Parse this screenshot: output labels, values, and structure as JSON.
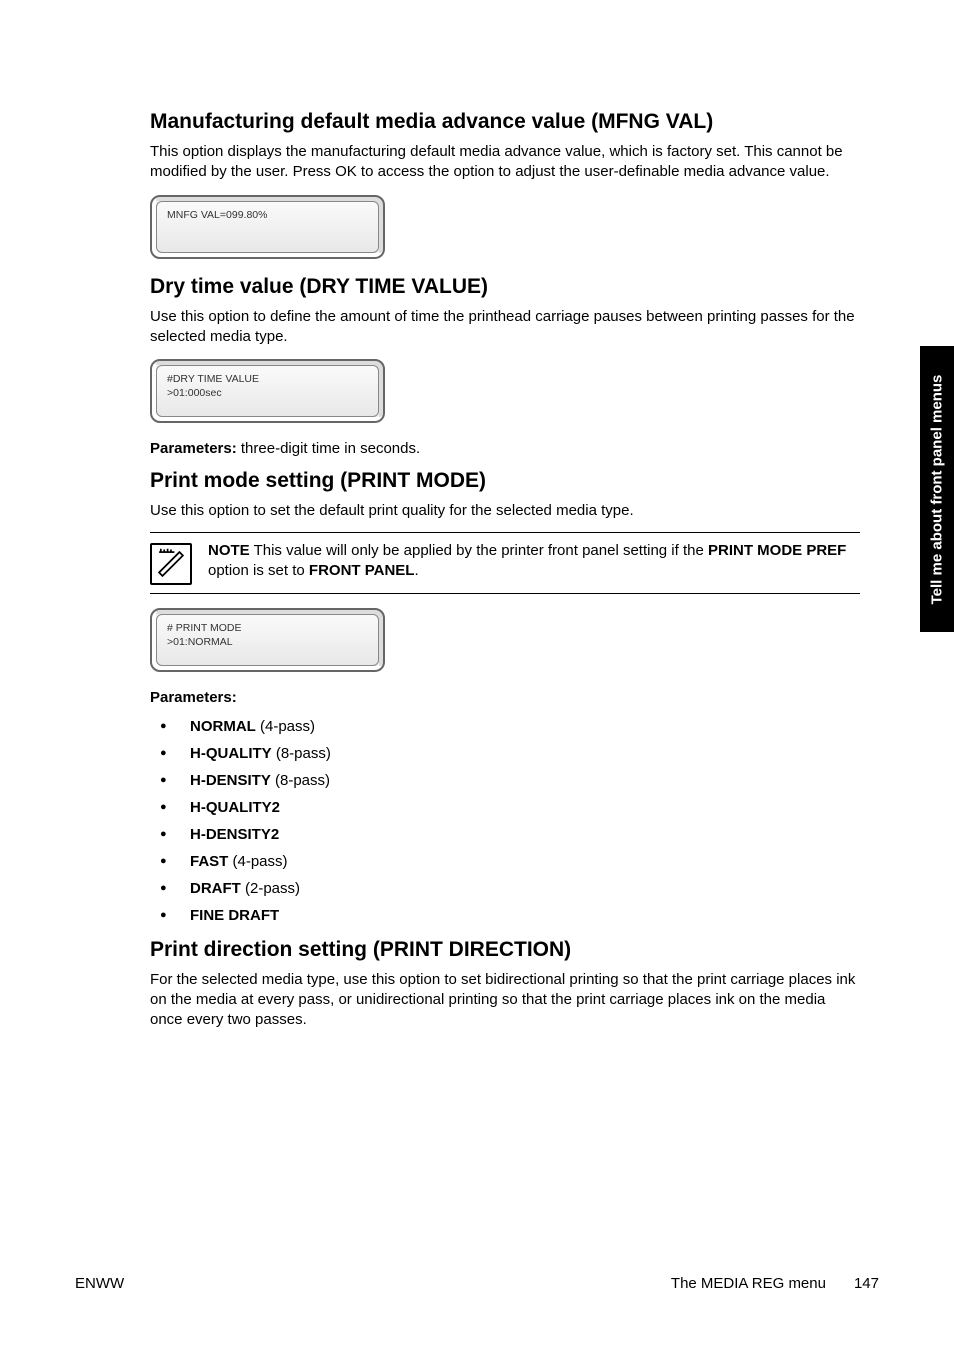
{
  "side_tab": "Tell me about front panel menus",
  "sections": {
    "mfng": {
      "heading": "Manufacturing default media advance value (MFNG VAL)",
      "para": "This option displays the manufacturing default media advance value, which is factory set. This cannot be modified by the user. Press OK to access the option to adjust the user-definable media advance value.",
      "lcd_l1": "MNFG VAL=099.80%",
      "lcd_l2": ""
    },
    "dry": {
      "heading": "Dry time value (DRY TIME VALUE)",
      "para": "Use this option to define the amount of time the printhead carriage pauses between printing passes for the selected media type.",
      "lcd_l1": "#DRY TIME VALUE",
      "lcd_l2": ">01:000sec",
      "params_label": "Parameters:",
      "params_text": " three-digit time in seconds."
    },
    "printmode": {
      "heading": "Print mode setting (PRINT MODE)",
      "para": "Use this option to set the default print quality for the selected media type.",
      "note_label": "NOTE",
      "note_pre": "   This value will only be applied by the printer front panel setting if the ",
      "note_bold1": "PRINT MODE PREF",
      "note_mid": " option is set to ",
      "note_bold2": "FRONT PANEL",
      "note_post": ".",
      "lcd_l1": "# PRINT MODE",
      "lcd_l2": ">01:NORMAL",
      "params_label": "Parameters:",
      "items": [
        {
          "b": "NORMAL",
          "rest": " (4-pass)"
        },
        {
          "b": "H-QUALITY",
          "rest": " (8-pass)"
        },
        {
          "b": "H-DENSITY",
          "rest": " (8-pass)"
        },
        {
          "b": "H-QUALITY2",
          "rest": ""
        },
        {
          "b": "H-DENSITY2",
          "rest": ""
        },
        {
          "b": "FAST",
          "rest": " (4-pass)"
        },
        {
          "b": "DRAFT",
          "rest": " (2-pass)"
        },
        {
          "b": "FINE DRAFT",
          "rest": ""
        }
      ]
    },
    "printdir": {
      "heading": "Print direction setting (PRINT DIRECTION)",
      "para": "For the selected media type, use this option to set bidirectional printing so that the print carriage places ink on the media at every pass, or unidirectional printing so that the print carriage places ink on the media once every two passes."
    }
  },
  "footer": {
    "left": "ENWW",
    "right_label": "The MEDIA REG menu",
    "page": "147"
  }
}
